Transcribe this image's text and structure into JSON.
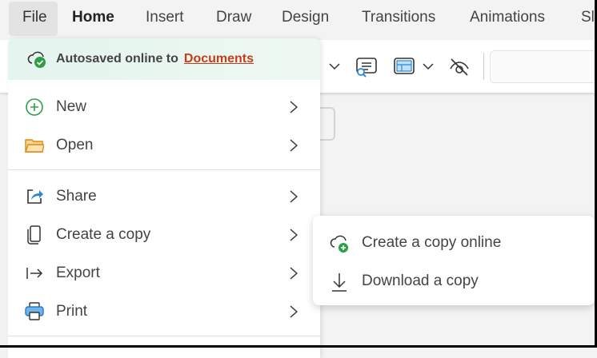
{
  "tabs": [
    "File",
    "Home",
    "Insert",
    "Draw",
    "Design",
    "Transitions",
    "Animations",
    "Sl"
  ],
  "autosave": {
    "text": "Autosaved online to",
    "link": "Documents"
  },
  "menu": [
    {
      "label": "New",
      "icon": "plus-circle-icon"
    },
    {
      "label": "Open",
      "icon": "folder-icon"
    },
    {
      "label": "Share",
      "icon": "share-icon"
    },
    {
      "label": "Create a copy",
      "icon": "copy-icon"
    },
    {
      "label": "Export",
      "icon": "export-icon"
    },
    {
      "label": "Print",
      "icon": "printer-icon"
    }
  ],
  "submenu": [
    {
      "label": "Create a copy online",
      "icon": "cloud-add-icon"
    },
    {
      "label": "Download a copy",
      "icon": "download-icon"
    }
  ],
  "colors": {
    "accent_link": "#c43e1c",
    "success": "#2e9e48",
    "blue": "#2b88d8"
  }
}
